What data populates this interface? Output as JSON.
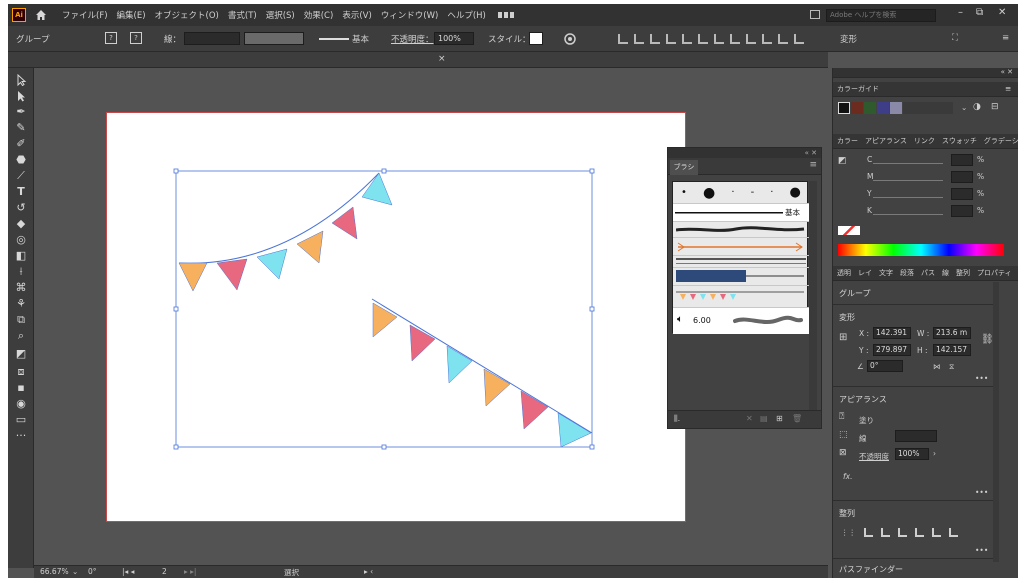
{
  "app": {
    "logo": "Ai"
  },
  "menu": [
    "ファイル(F)",
    "編集(E)",
    "オブジェクト(O)",
    "書式(T)",
    "選択(S)",
    "効果(C)",
    "表示(V)",
    "ウィンドウ(W)",
    "ヘルプ(H)"
  ],
  "search": {
    "placeholder": "Adobe ヘルプを検索"
  },
  "window_controls": {
    "minimize": "–",
    "restore": "⧉",
    "close": "✕"
  },
  "control_bar": {
    "selection": "グループ",
    "stroke_label": "線：",
    "stroke_style": "基本",
    "opacity_label": "不透明度：",
    "opacity_value": "100%",
    "style_label": "スタイル：",
    "transform_label": "変形"
  },
  "brush_panel": {
    "tab": "ブラシ",
    "size_value": "6.00",
    "basic_label": "基本",
    "dots": [
      "•",
      "●",
      "·",
      "-",
      "·",
      "●"
    ]
  },
  "right_dock": {
    "color_guide_tab": "カラーガイド",
    "color_tabs": "カラー　アピアランス　リンク　スウォッチ　グラデーション",
    "channels": [
      "C",
      "M",
      "Y",
      "K"
    ],
    "percent": "%",
    "props_tabs": "透明　レイ　文字　段落　パス　線　整列　プロパティ",
    "group_label": "グループ",
    "transform_title": "変形",
    "x_label": "X :",
    "x_value": "142.391",
    "y_label": "Y :",
    "y_value": "279.897",
    "w_label": "W :",
    "w_value": "213.6 m",
    "h_label": "H :",
    "h_value": "142.157",
    "angle_value": "0°",
    "appearance_title": "アピアランス",
    "fill_label": "塗り",
    "stroke_label": "線",
    "opacity_label": "不透明度",
    "opacity_value": "100%",
    "fx_label": "fx.",
    "align_title": "整列",
    "pathfinder_title": "パスファインダー",
    "more": "•••"
  },
  "status_bar": {
    "zoom": "66.67%",
    "rotation": "0°",
    "artboard_index": "2",
    "mode": "選択"
  },
  "colors": {
    "orange": "#f7b15e",
    "pink": "#e8687f",
    "cyan": "#7ee3ee",
    "selection_blue": "#4a74d8"
  },
  "swatches": [
    "#111111",
    "#6b2b1e",
    "#2f5a2d",
    "#3e3e88",
    "#8a8aa8"
  ],
  "icons": [
    "home-icon",
    "search-icon",
    "close-icon",
    "menu-icon",
    "link-icon"
  ]
}
